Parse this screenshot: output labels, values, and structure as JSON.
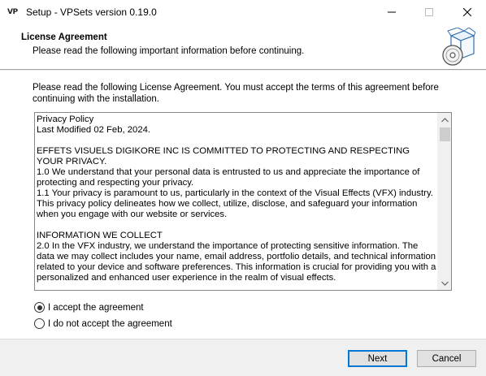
{
  "window": {
    "app_icon_text": "VP",
    "title": "Setup - VPSets version 0.19.0"
  },
  "header": {
    "title": "License Agreement",
    "subtitle": "Please read the following important information before continuing.",
    "icon": "setup-box-icon"
  },
  "content": {
    "intro": "Please read the following License Agreement. You must accept the terms of this agreement before continuing with the installation.",
    "license_text": "Privacy Policy\nLast Modified 02 Feb, 2024.\n\nEFFETS VISUELS DIGIKORE INC IS COMMITTED TO PROTECTING AND RESPECTING YOUR PRIVACY.\n1.0 We understand that your personal data is entrusted to us and appreciate the importance of protecting and respecting your privacy.\n1.1 Your privacy is paramount to us, particularly in the context of the Visual Effects (VFX) industry. This privacy policy delineates how we collect, utilize, disclose, and safeguard your information when you engage with our website or services.\n\nINFORMATION WE COLLECT\n2.0 In the VFX industry, we understand the importance of protecting sensitive information. The data we may collect includes your name, email address, portfolio details, and technical information related to your device and software preferences. This information is crucial for providing you with a personalized and enhanced user experience in the realm of visual effects.\n\nWHEN DO WE COLLECT PERSONAL DATA ABOUT YOU"
  },
  "options": {
    "accept_label": "I accept the agreement",
    "decline_label": "I do not accept the agreement",
    "selected": "accept"
  },
  "buttons": {
    "next_label": "Next",
    "cancel_label": "Cancel"
  }
}
